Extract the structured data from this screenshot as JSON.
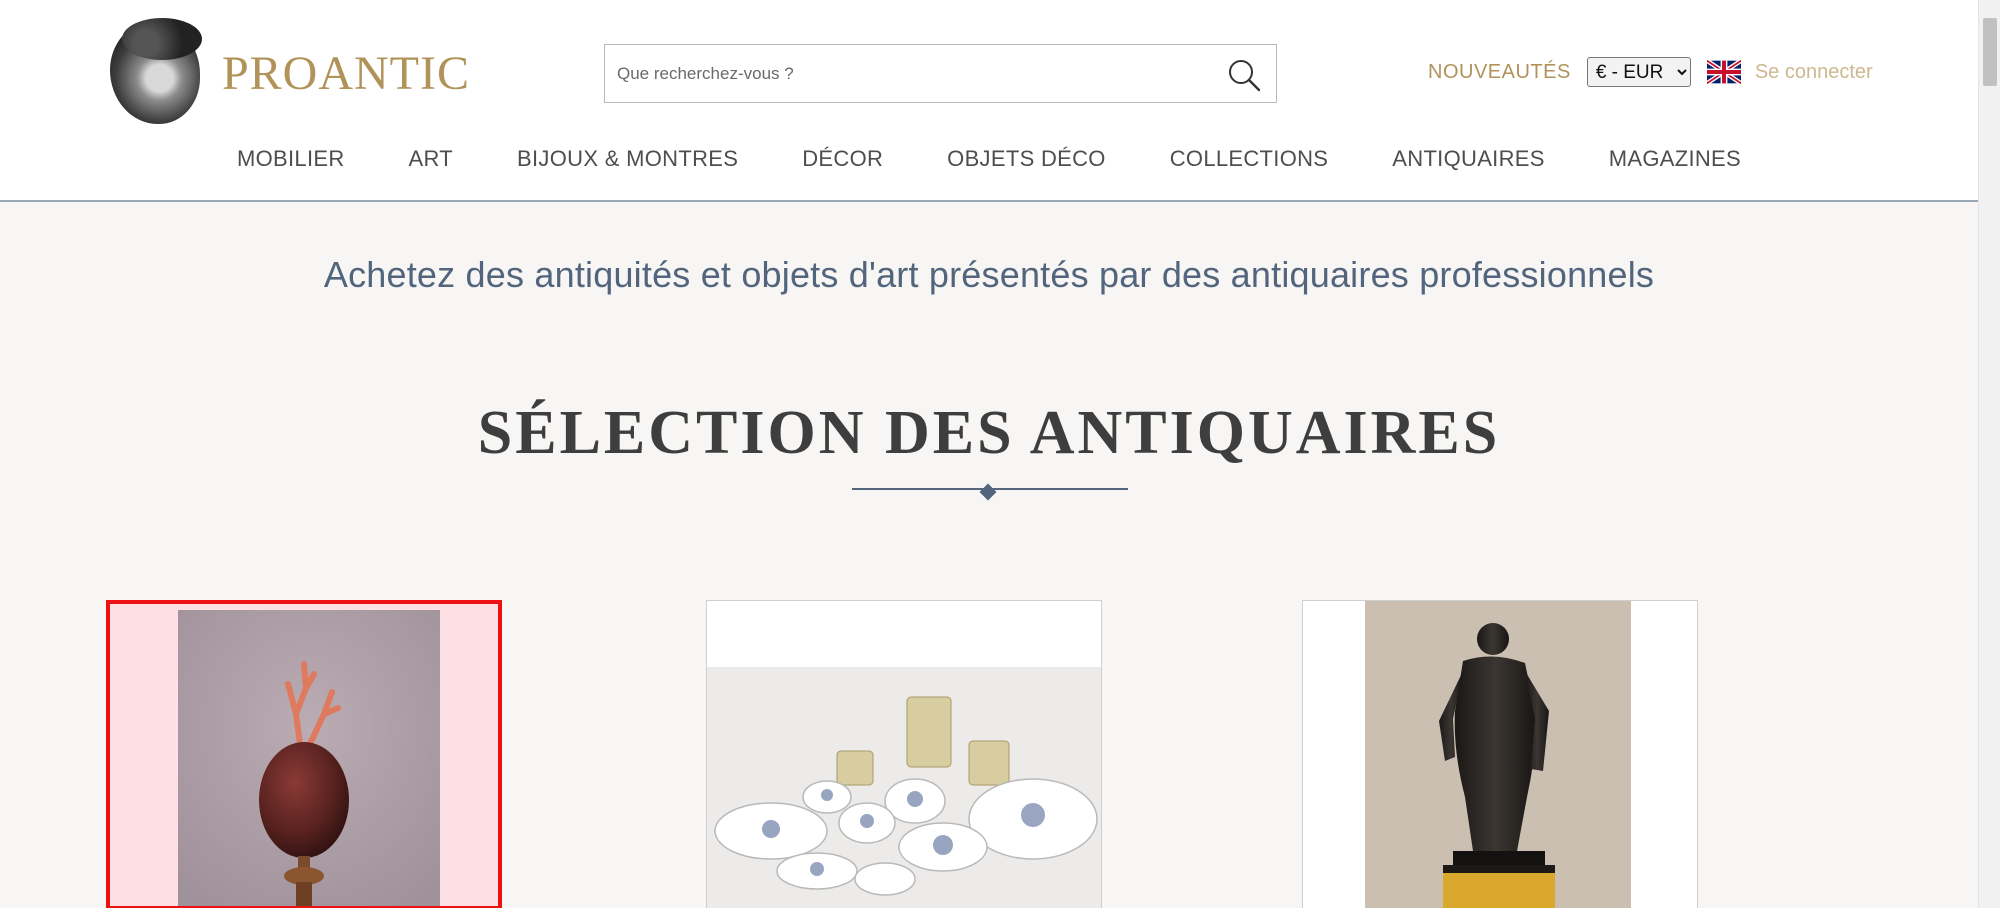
{
  "header": {
    "logo_text": "PROANTIC",
    "search": {
      "placeholder": "Que recherchez-vous ?"
    },
    "nouveautes_label": "NOUVEAUTÉS",
    "currency": {
      "selected": "€ - EUR"
    },
    "language_icon": "uk-flag-icon",
    "login_label": "Se connecter"
  },
  "nav": {
    "items": [
      {
        "label": "MOBILIER"
      },
      {
        "label": "ART"
      },
      {
        "label": "BIJOUX & MONTRES"
      },
      {
        "label": "DÉCOR"
      },
      {
        "label": "OBJETS DÉCO"
      },
      {
        "label": "COLLECTIONS"
      },
      {
        "label": "ANTIQUAIRES"
      },
      {
        "label": "MAGAZINES"
      }
    ]
  },
  "main": {
    "tagline": "Achetez des antiquités et objets d'art présentés par des antiquaires professionnels",
    "section_title": "SÉLECTION DES ANTIQUAIRES",
    "cards": [
      {
        "image": "egg-with-coral-on-stand",
        "selected": true
      },
      {
        "image": "porcelain-dinner-service"
      },
      {
        "image": "bronze-hercules-statue"
      }
    ]
  },
  "colors": {
    "brand_gold": "#b1935a",
    "accent_blue": "#52657c",
    "selection_red": "#ee1111"
  }
}
